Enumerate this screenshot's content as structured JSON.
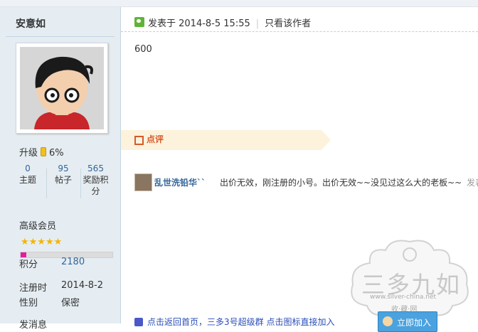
{
  "user": {
    "name": "安意如",
    "level_label": "升级",
    "level_percent": "6%",
    "level_progress": 0.06,
    "stats": [
      {
        "value": "0",
        "label": "主题"
      },
      {
        "value": "95",
        "label": "帖子"
      },
      {
        "value": "565",
        "label": "奖励积分"
      }
    ],
    "group": "高级会员",
    "stars": "★★★★★",
    "progress_color": "#e31e9e",
    "points_label": "积分",
    "points_value": "2180",
    "registered_label": "注册时",
    "registered_value": "2014-8-2",
    "gender_label": "性别",
    "gender_value": "保密",
    "next_label": "发消息"
  },
  "post": {
    "posted_label": "发表于 2014-8-5 15:55",
    "only_author": "只看该作者",
    "content": "600"
  },
  "rating": {
    "label": "点评"
  },
  "comment": {
    "author": "乱世洗铅华``",
    "text": "出价无效，刚注册的小号。出价无效~~没见过这么大的老板~~",
    "time": "发表"
  },
  "watermark": {
    "text": "三多九如",
    "url": "www.silver-china.net",
    "sub": "收·藏·网"
  },
  "footer": {
    "link": "点击返回首页，三多3号超级群 点击图标直接加入",
    "join_button": "立即加入"
  },
  "colors": {
    "sidebar_bg": "#e5edf2",
    "link": "#336699",
    "rate_accent": "#d65a2a"
  }
}
